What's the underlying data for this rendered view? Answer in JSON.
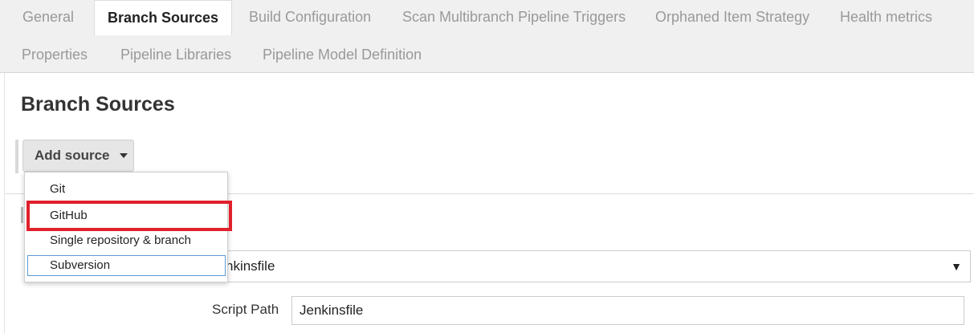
{
  "tabs": [
    {
      "label": "General",
      "active": false
    },
    {
      "label": "Branch Sources",
      "active": true
    },
    {
      "label": "Build Configuration",
      "active": false
    },
    {
      "label": "Scan Multibranch Pipeline Triggers",
      "active": false
    },
    {
      "label": "Orphaned Item Strategy",
      "active": false
    },
    {
      "label": "Health metrics",
      "active": false
    },
    {
      "label": "Properties",
      "active": false
    },
    {
      "label": "Pipeline Libraries",
      "active": false
    },
    {
      "label": "Pipeline Model Definition",
      "active": false
    }
  ],
  "section": {
    "title": "Branch Sources"
  },
  "add_source": {
    "label": "Add source"
  },
  "dropdown": {
    "items": [
      {
        "label": "Git"
      },
      {
        "label": "GitHub",
        "highlighted": true
      },
      {
        "label": "Single repository & branch"
      },
      {
        "label": "Subversion",
        "focused": true
      }
    ],
    "highlight_color": "#e0202b"
  },
  "build_config": {
    "mode_value": "nkinsfile",
    "arrow": "▼"
  },
  "script_path": {
    "label": "Script Path",
    "value": "Jenkinsfile"
  }
}
